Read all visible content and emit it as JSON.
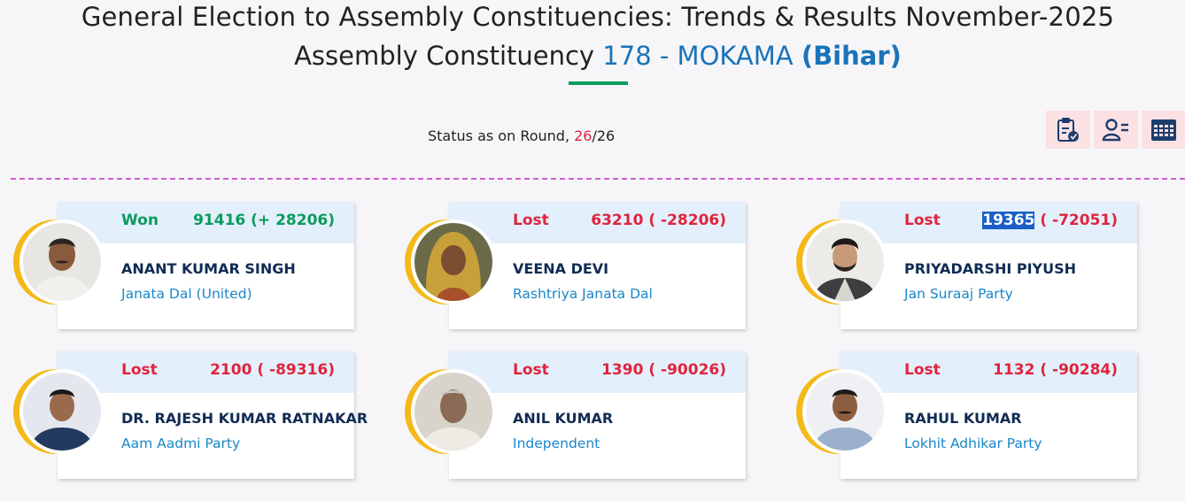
{
  "header": {
    "title_line1": "General Election to Assembly Constituencies: Trends & Results November-2025",
    "title_line2_prefix": "Assembly Constituency ",
    "constituency": "178 - MOKAMA",
    "state": "(Bihar)"
  },
  "status": {
    "prefix": "Status as on Round, ",
    "current_round": "26",
    "separator": "/",
    "total_rounds": "26"
  },
  "toolbar": {
    "icons": [
      "clipboard-report-icon",
      "candidate-list-icon",
      "table-grid-icon"
    ]
  },
  "colors": {
    "won": "#0c9b5e",
    "lost": "#e0243e",
    "name": "#102c54",
    "party": "#1a86c8",
    "ring": "#f3b919",
    "accent": "#1a73b8"
  },
  "candidates": [
    {
      "status": "Won",
      "votes": "91416",
      "margin": " (+ 28206)",
      "name": "ANANT KUMAR SINGH",
      "party": "Janata Dal (United)"
    },
    {
      "status": "Lost",
      "votes": "63210",
      "margin": " ( -28206)",
      "name": "VEENA DEVI",
      "party": "Rashtriya Janata Dal"
    },
    {
      "status": "Lost",
      "votes": "19365",
      "margin": " ( -72051)",
      "name": "PRIYADARSHI PIYUSH",
      "party": "Jan Suraaj Party"
    },
    {
      "status": "Lost",
      "votes": "2100",
      "margin": " ( -89316)",
      "name": "DR. RAJESH KUMAR RATNAKAR",
      "party": "Aam Aadmi Party"
    },
    {
      "status": "Lost",
      "votes": "1390",
      "margin": " ( -90026)",
      "name": "ANIL KUMAR",
      "party": "Independent"
    },
    {
      "status": "Lost",
      "votes": "1132",
      "margin": " ( -90284)",
      "name": "RAHUL KUMAR",
      "party": "Lokhit Adhikar Party"
    }
  ]
}
